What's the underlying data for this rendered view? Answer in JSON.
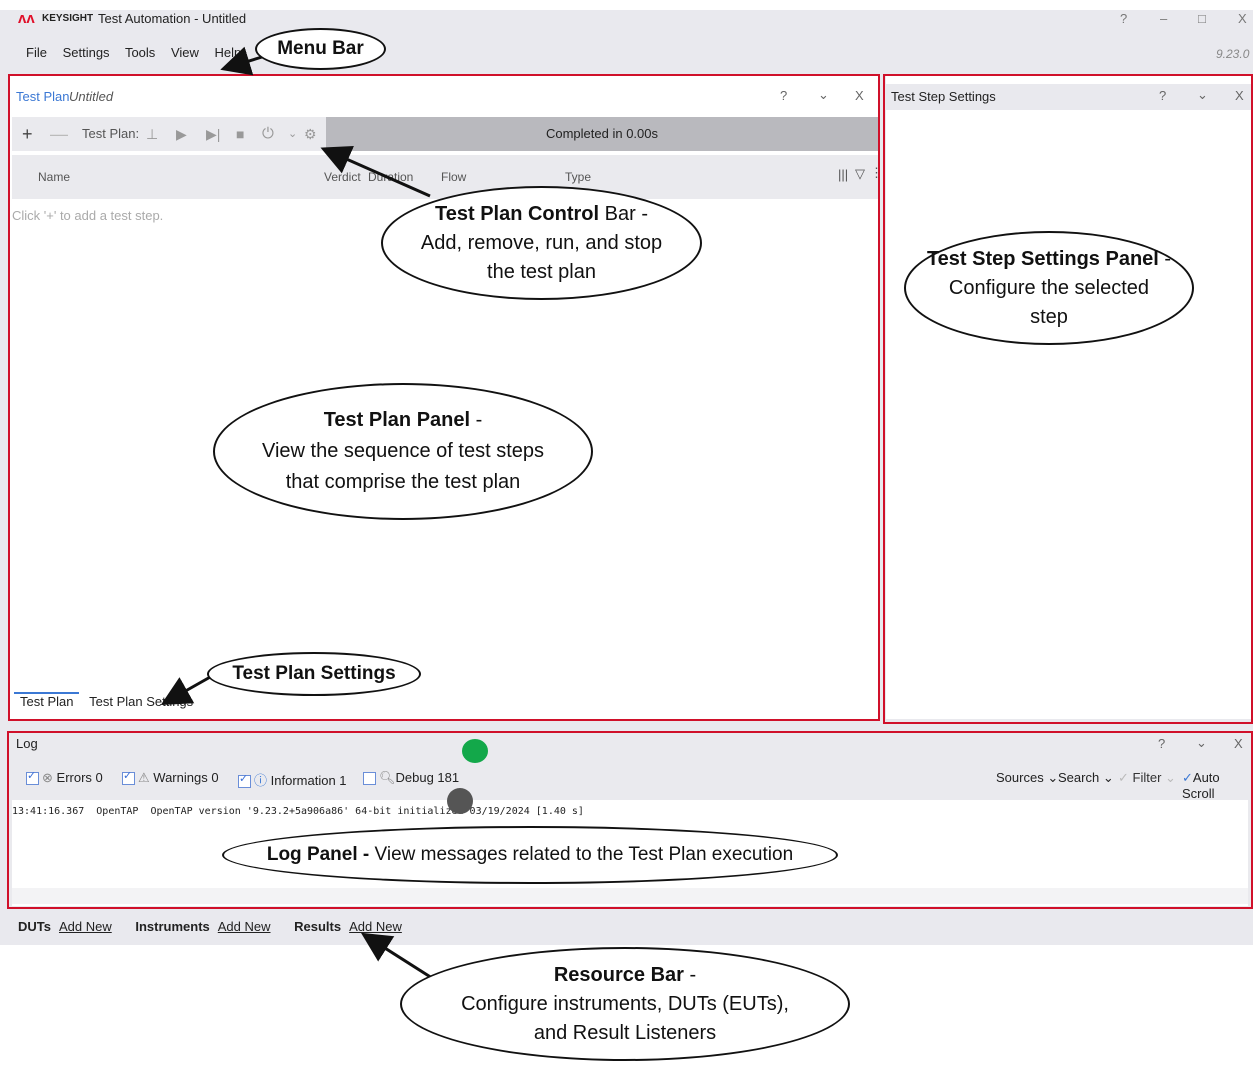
{
  "app": {
    "logo_text": "KEYSIGHT",
    "title": "Test Automation - Untitled",
    "version": "9.23.0",
    "window_controls": [
      "?",
      "–",
      "□",
      "X"
    ]
  },
  "menu": [
    "File",
    "Settings",
    "Tools",
    "View",
    "Help"
  ],
  "test_plan_panel": {
    "title": "Test Plan",
    "subtitle": "Untitled",
    "controls": [
      "?",
      "⌄",
      "X"
    ],
    "toolbar_label": "Test Plan:",
    "status": "Completed in 0.00s",
    "columns": [
      "Name",
      "Verdict",
      "Duration",
      "Flow",
      "Type"
    ],
    "empty_hint": "Click '+' to add a test step.",
    "tabs": [
      "Test Plan",
      "Test Plan Settings"
    ]
  },
  "step_settings_panel": {
    "title": "Test Step Settings",
    "controls": [
      "?",
      "⌄",
      "X"
    ]
  },
  "log_panel": {
    "title": "Log",
    "controls": [
      "?",
      "⌄",
      "X"
    ],
    "filters": {
      "errors": "Errors 0",
      "warnings": "Warnings 0",
      "information": "Information 1",
      "debug": "Debug 181"
    },
    "right_controls": [
      "Sources",
      "Search",
      "Filter",
      "Auto Scroll"
    ],
    "line": "13:41:16.367  OpenTAP  OpenTAP version '9.23.2+5a906a86' 64-bit initialized 03/19/2024 [1.40 s]"
  },
  "resource_bar": [
    {
      "label": "DUTs",
      "link": "Add New"
    },
    {
      "label": "Instruments",
      "link": "Add New"
    },
    {
      "label": "Results",
      "link": "Add New"
    }
  ],
  "annotations": {
    "menu_bar": "Menu Bar",
    "control_bar_bold": "Test Plan Control",
    "control_bar_rest": " Bar -",
    "control_bar_l2": "Add, remove, run, and stop",
    "control_bar_l3": "the test plan",
    "step_settings_bold": "Test Step Settings Panel",
    "step_settings_rest": " -",
    "step_settings_l2": "Configure the selected",
    "step_settings_l3": "step",
    "plan_panel_bold": "Test Plan Panel",
    "plan_panel_rest": " -",
    "plan_panel_l2": "View the sequence of test steps",
    "plan_panel_l3": "that comprise the test plan",
    "plan_settings": "Test Plan Settings",
    "log_bold": "Log Panel -",
    "log_rest": " View messages related to the Test Plan execution",
    "resource_bold": "Resource Bar",
    "resource_rest": " -",
    "resource_l2": "Configure instruments, DUTs (EUTs),",
    "resource_l3": "and Result Listeners"
  }
}
